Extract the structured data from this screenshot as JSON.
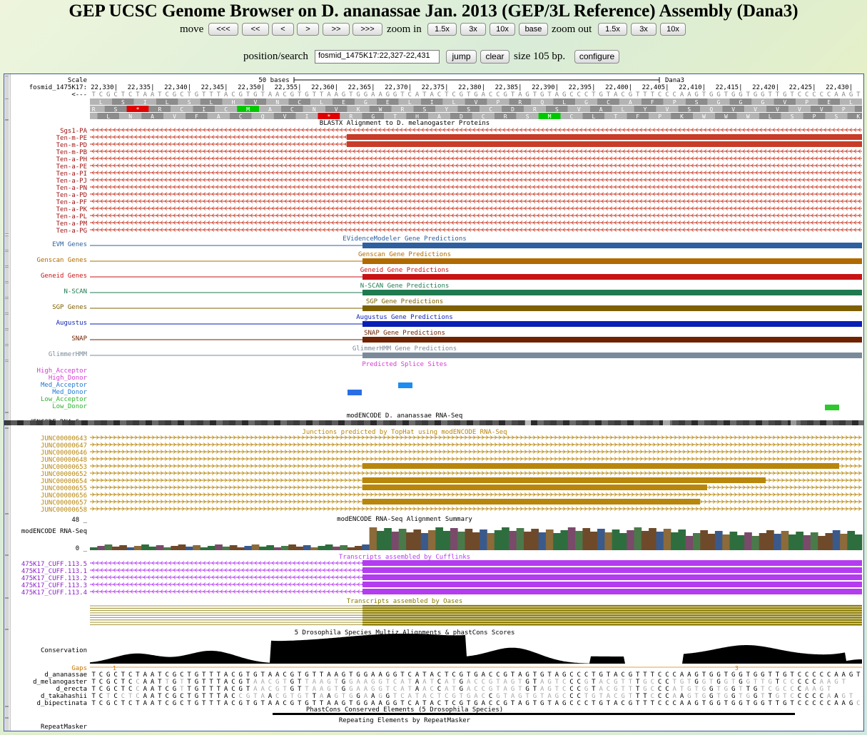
{
  "header": {
    "title": "GEP UCSC Genome Browser on D. ananassae Jan. 2013 (GEP/3L Reference) Assembly (Dana3)"
  },
  "nav": {
    "move_label": "move",
    "move_buttons": [
      "<<<",
      "<<",
      "<",
      ">",
      ">>",
      ">>>"
    ],
    "zoom_in_label": "zoom in",
    "zoom_in_buttons": [
      "1.5x",
      "3x",
      "10x"
    ],
    "base_button": "base",
    "zoom_out_label": "zoom out",
    "zoom_out_buttons": [
      "1.5x",
      "3x",
      "10x"
    ]
  },
  "search": {
    "label": "position/search",
    "value": "fosmid_1475K17:22,327-22,431",
    "jump": "jump",
    "clear": "clear",
    "size_text": "size 105 bp.",
    "configure": "configure"
  },
  "ruler": {
    "scale_label": "Scale",
    "scale_text": "50 bases",
    "assembly": "Dana3",
    "chrom_label": "fosmid_1475K17:",
    "strand_label": "<---",
    "ticks": [
      "22,330|",
      "22,335|",
      "22,340|",
      "22,345|",
      "22,350|",
      "22,355|",
      "22,360|",
      "22,365|",
      "22,370|",
      "22,375|",
      "22,380|",
      "22,385|",
      "22,390|",
      "22,395|",
      "22,400|",
      "22,405|",
      "22,410|",
      "22,415|",
      "22,420|",
      "22,425|",
      "22,430|"
    ]
  },
  "sequence": "TCGCTCTAATCGCTGTTTACGTGTAACGTGTTAAGTGGAAGGTCATACTCGTGACCGTAGTGTAGCCCTGTACGTTTCCCAAGTGGTGGTGGTTGTCCCCCAAGT",
  "translation": {
    "frame1": "LSILSLHVNCLEGELILVPRQLGCAFPSGGGVPE",
    "frame2": "RS*RCICMACNVKWRSYSCDRSVALYVSQVVVVVPQ",
    "frame3": "ALNAVFACQVI*RGTHADCRSMCLTFPKWWWLSPSK"
  },
  "tracks": {
    "blastx": {
      "title": "BLASTX Alignment to D. melanogaster Proteins",
      "items": [
        "Sgs1-PA",
        "Ten-m-PE",
        "Ten-m-PD",
        "Ten-m-PB",
        "Ten-a-PH",
        "Ten-a-PE",
        "Ten-a-PI",
        "Ten-a-PJ",
        "Ten-a-PN",
        "Ten-a-PD",
        "Ten-a-PF",
        "Ten-a-PK",
        "Ten-a-PL",
        "Ten-a-PM",
        "Ten-a-PG"
      ]
    },
    "genepred": [
      {
        "label": "EVM Genes",
        "title": "EVidenceModeler Gene Predictions",
        "color": "#2e5f9e"
      },
      {
        "label": "Genscan Genes",
        "title": "Genscan Gene Predictions",
        "color": "#b06a00"
      },
      {
        "label": "Geneid Genes",
        "title": "Geneid Gene Predictions",
        "color": "#c81414"
      },
      {
        "label": "N-SCAN",
        "title": "N-SCAN Gene Predictions",
        "color": "#1f7a50"
      },
      {
        "label": "SGP Genes",
        "title": "SGP Gene Predictions",
        "color": "#7d6000"
      },
      {
        "label": "Augustus",
        "title": "Augustus Gene Predictions",
        "color": "#0a1fb4"
      },
      {
        "label": "SNAP",
        "title": "SNAP Gene Predictions",
        "color": "#6e2200"
      },
      {
        "label": "GlimmerHMM",
        "title": "GlimmerHMM Gene Predictions",
        "color": "#7a8a9a"
      }
    ],
    "splice": {
      "title": "Predicted Splice Sites",
      "labels": [
        {
          "text": "High_Acceptor",
          "color": "#d23cd2"
        },
        {
          "text": "High_Donor",
          "color": "#d23cd2"
        },
        {
          "text": "Med_Acceptor",
          "color": "#1e78d2"
        },
        {
          "text": "Med_Donor",
          "color": "#1e78d2"
        },
        {
          "text": "Low_Acceptor",
          "color": "#2db42d"
        },
        {
          "text": "Low_Donor",
          "color": "#2db42d"
        }
      ]
    },
    "rnaseq": {
      "title": "modENCODE D. ananassae RNA-Seq",
      "label": "modENCODE RNA-Seq"
    },
    "junctions": {
      "title": "Junctions predicted by TopHat using modENCODE RNA-Seq",
      "items": [
        "JUNC00000643",
        "JUNC00000647",
        "JUNC00000646",
        "JUNC00000648",
        "JUNC00000653",
        "JUNC00000652",
        "JUNC00000654",
        "JUNC00000655",
        "JUNC00000656",
        "JUNC00000657",
        "JUNC00000658"
      ]
    },
    "summary": {
      "title": "modENCODE RNA-Seq Alignment Summary",
      "label": "modENCODE RNA-Seq",
      "max": "48 _",
      "min": "0 _"
    },
    "cufflinks": {
      "title": "Transcripts assembled by Cufflinks",
      "items": [
        "475K17_CUFF.113.5",
        "475K17_CUFF.113.1",
        "475K17_CUFF.113.2",
        "475K17_CUFF.113.3",
        "475K17_CUFF.113.4"
      ]
    },
    "oases": {
      "title": "Transcripts assembled by Oases"
    },
    "conservation": {
      "title": "5 Drosophila Species Multiz Alignments & phastCons Scores",
      "label": "Conservation",
      "gaps": "Gaps",
      "gap_marks": [
        "1",
        "3"
      ],
      "species": [
        {
          "name": "d_ananassae",
          "seq": "TCGCTCTAATCGCTGTTTACGTGTAACGTGTTAAGTGGAAGGTCATACTCGTGACCGTAGTGTAGCCCTGTACGTTTCCCAAGTGGTGGTGGTTGTCCCCCAAGT"
        },
        {
          "name": "d_melanogaster",
          "seq": "TCGCTCCAATTGTTGTTTACGTAACGTGTTAAGTGGAAGGTCATAATCATGACCGTAGTGTAGTCCCGTACGTTTGCCCTGTGGTGGTGGTTGTCCCCCAAGT"
        },
        {
          "name": "d_erecta",
          "seq": "TCGCTCCAATCGTTGTTTACGTAACGTGTTAAGTGGAAGGTCATAACCATGACCGTAGTGTAGTCCCGTACGTTTGCCCATGTGGTGGTTGTCGCCCAAGT"
        },
        {
          "name": "d_takahashii",
          "seq": "TCTCCTCAATCGCTGTTTACCGTAACGTGTTAAGTGGAAGGTCATACTCGTGACCGTAGTGTAGCCCTGTACGTTTCCCAAGTGGTGGTGGTTGTCCCCCAAGT"
        },
        {
          "name": "d_bipectinata",
          "seq": "TCGCTCTAATCGCTGTTTACGTGTAACGTGTTAAGTGGAAGGTCATACTCGTGACCGTAGTGTAGCCCTGTACGTTTCCCAAGTGGTGGTGGTTGTCCCCCAAGC"
        }
      ]
    },
    "phastcons": {
      "title": "PhastCons Conserved Elements (5 Drosophila Species)"
    },
    "repeatmasker": {
      "title": "Repeating Elements by RepeatMasker",
      "label": "RepeatMasker"
    }
  },
  "colors": {
    "blastx_feature": "#c83c28",
    "junction": "#b8860b",
    "cufflinks": "#b43cf0",
    "oases": "#8a7a00",
    "ruler_text": "#000000",
    "coverage_palette": [
      "#2e6e3e",
      "#8c6a3a",
      "#3a5a8c",
      "#6e4a2a",
      "#4a7a4a",
      "#7a4a6a"
    ]
  }
}
